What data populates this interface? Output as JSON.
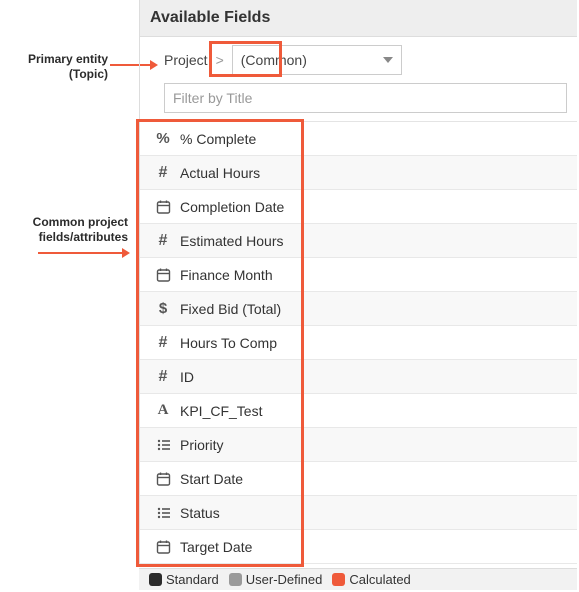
{
  "header": {
    "title": "Available Fields"
  },
  "breadcrumb": {
    "root": "Project",
    "sep": ">",
    "selected": "(Common)"
  },
  "filter": {
    "placeholder": "Filter by Title"
  },
  "fields": [
    {
      "icon": "percent-icon",
      "label": "% Complete"
    },
    {
      "icon": "hash-icon",
      "label": "Actual Hours"
    },
    {
      "icon": "calendar-icon",
      "label": "Completion Date"
    },
    {
      "icon": "hash-icon",
      "label": "Estimated Hours"
    },
    {
      "icon": "calendar-icon",
      "label": "Finance Month"
    },
    {
      "icon": "dollar-icon",
      "label": "Fixed Bid (Total)"
    },
    {
      "icon": "hash-icon",
      "label": "Hours To Comp"
    },
    {
      "icon": "hash-icon",
      "label": "ID"
    },
    {
      "icon": "letter-a-icon",
      "label": "KPI_CF_Test",
      "red": true
    },
    {
      "icon": "list-icon",
      "label": "Priority"
    },
    {
      "icon": "calendar-icon",
      "label": "Start Date"
    },
    {
      "icon": "list-icon",
      "label": "Status"
    },
    {
      "icon": "calendar-icon",
      "label": "Target Date"
    }
  ],
  "legend": {
    "standard": "Standard",
    "user": "User-Defined",
    "calculated": "Calculated"
  },
  "annotations": {
    "primary_l1": "Primary entity",
    "primary_l2": "(Topic)",
    "common_l1": "Common project",
    "common_l2": "fields/attributes"
  }
}
